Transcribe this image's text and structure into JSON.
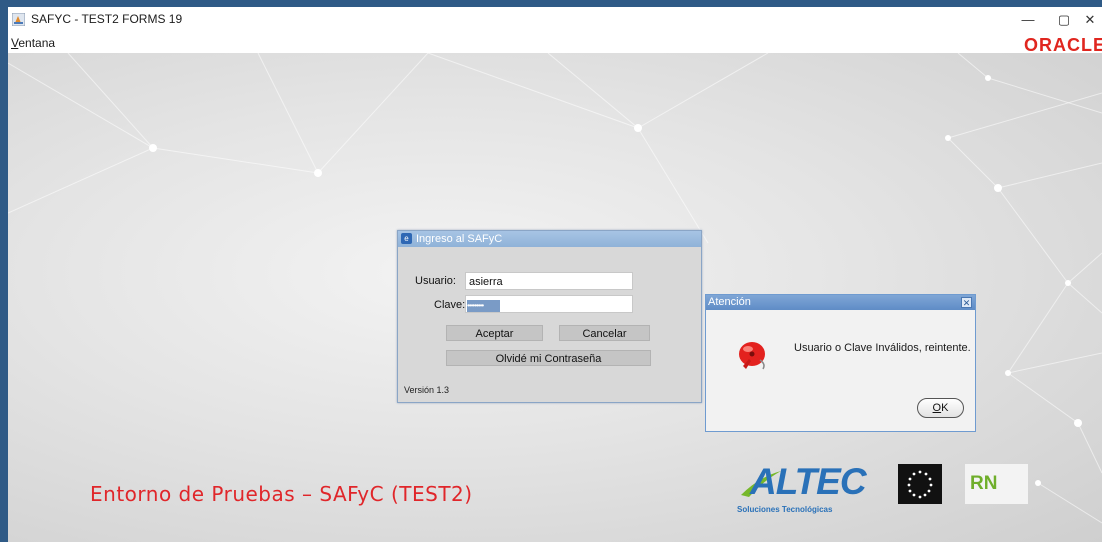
{
  "window": {
    "title": "SAFYC - TEST2 FORMS 19",
    "minimize": "—",
    "restore": "▢",
    "close": "✕"
  },
  "menu": {
    "ventana_first": "V",
    "ventana_rest": "entana"
  },
  "brand": {
    "oracle": "ORACLE",
    "oracle_color": "#e0261f"
  },
  "login": {
    "title": "Ingreso al SAFyC",
    "usuario_label": "Usuario:",
    "usuario_value": "asierra",
    "clave_label": "Clave:",
    "clave_value": "•••••••••",
    "aceptar": "Aceptar",
    "cancelar": "Cancelar",
    "olvide": "Olvidé mi Contraseña",
    "version": "Versión 1.3"
  },
  "alert": {
    "title": "Atención",
    "message": "Usuario o Clave Inválidos, reintente.",
    "ok_first": "O",
    "ok_rest": "K",
    "close": "✕"
  },
  "footer": {
    "environment": "Entorno de Pruebas – SAFyC (TEST2)",
    "altec": "ALTEC",
    "altec_sub": "Soluciones Tecnológicas",
    "rn": "RN"
  }
}
